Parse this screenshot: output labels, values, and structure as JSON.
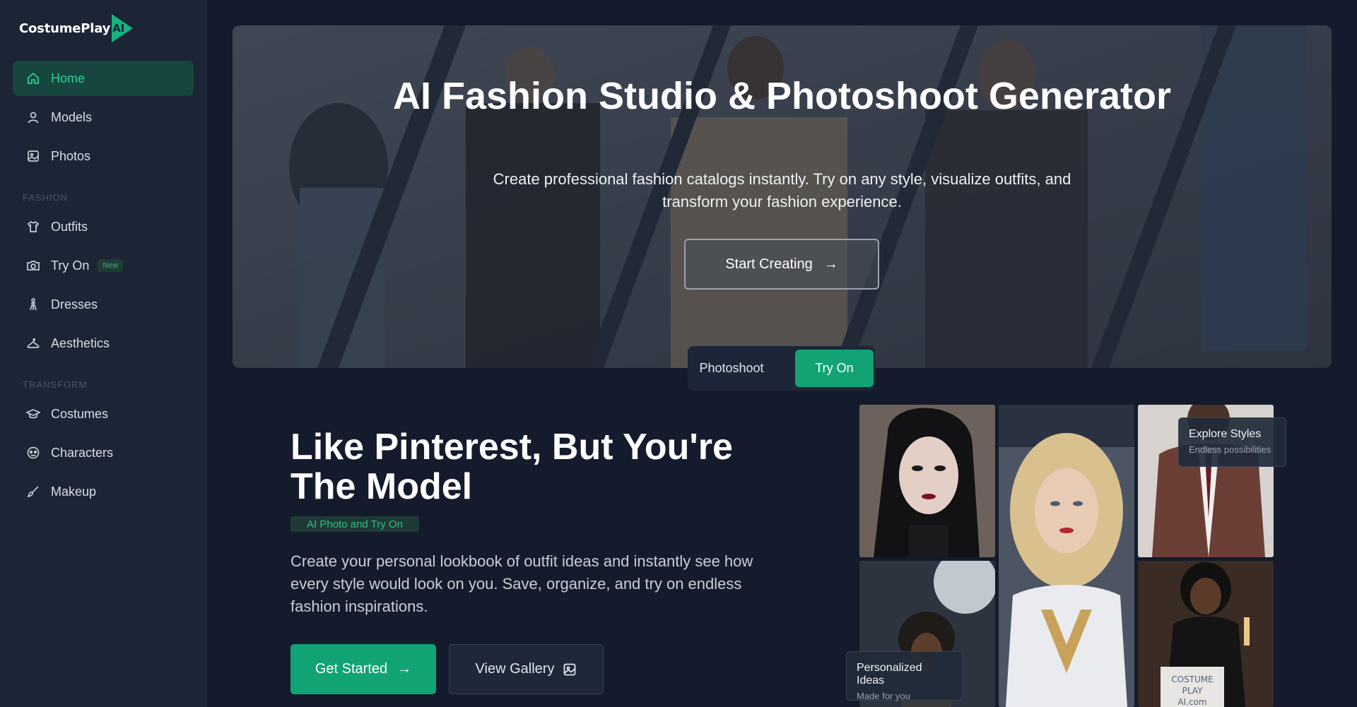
{
  "brand": {
    "name": "CostumePlay",
    "mark": "AI"
  },
  "sidebar": {
    "items": [
      {
        "label": "Home",
        "icon": "home-icon",
        "active": true
      },
      {
        "label": "Models",
        "icon": "user-icon"
      },
      {
        "label": "Photos",
        "icon": "image-icon"
      },
      {
        "label": "Outfits",
        "icon": "shirt-icon"
      },
      {
        "label": "Try On",
        "icon": "camera-icon",
        "badge": "New"
      },
      {
        "label": "Dresses",
        "icon": "dress-icon"
      },
      {
        "label": "Aesthetics",
        "icon": "hanger-icon"
      },
      {
        "label": "Costumes",
        "icon": "graduation-cap-icon"
      },
      {
        "label": "Characters",
        "icon": "mask-icon"
      },
      {
        "label": "Makeup",
        "icon": "brush-icon"
      }
    ],
    "sections": {
      "fashion": "FASHION",
      "transform": "TRANSFORM"
    }
  },
  "hero": {
    "title": "AI Fashion Studio & Photoshoot Generator",
    "subtitle": "Create professional fashion catalogs instantly. Try on any style, visualize outfits, and transform your fashion experience.",
    "cta": "Start Creating",
    "cta_arrow": "→"
  },
  "toggle": {
    "option1": "Photoshoot",
    "option2": "Try On",
    "selected": "Try On"
  },
  "feature": {
    "title": "Like Pinterest, But You're The Model",
    "tag": "AI Photo and Try On",
    "description": "Create your personal lookbook of outfit ideas and instantly see how every style would look on you. Save, organize, and try on endless fashion inspirations.",
    "primary_button": "Get Started",
    "primary_arrow": "→",
    "secondary_button": "View Gallery"
  },
  "gallery": {
    "card_top": {
      "title": "Explore Styles",
      "subtitle": "Endless possibilities"
    },
    "card_bottom": {
      "title": "Personalized Ideas",
      "subtitle": "Made for you"
    }
  },
  "colors": {
    "accent": "#12a374",
    "background": "#141b2c",
    "sidebar": "#1c2535"
  }
}
